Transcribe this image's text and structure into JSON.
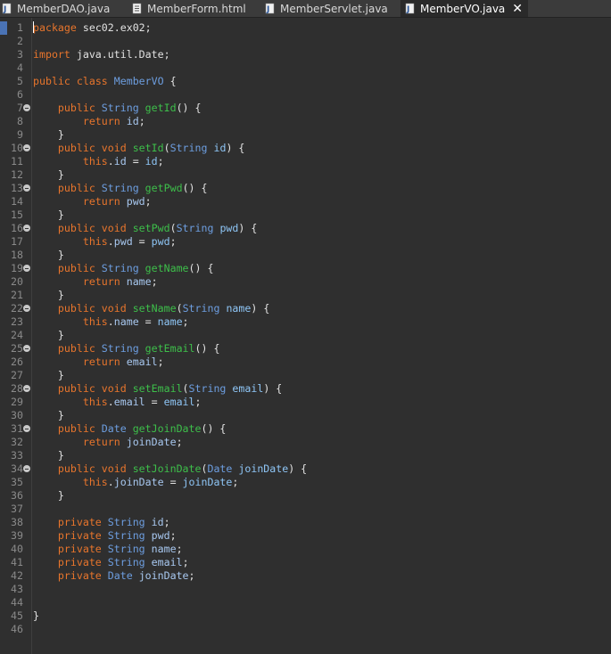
{
  "tabs": [
    {
      "label": "MemberDAO.java",
      "icon": "java-file-icon",
      "active": false
    },
    {
      "label": "MemberForm.html",
      "icon": "html-file-icon",
      "active": false
    },
    {
      "label": "MemberServlet.java",
      "icon": "java-file-icon",
      "active": false
    },
    {
      "label": "MemberVO.java",
      "icon": "java-file-icon",
      "active": true,
      "close": "✕"
    }
  ],
  "editor": {
    "lines": [
      {
        "n": "1",
        "fold": false,
        "segs": [
          [
            "package",
            "k"
          ],
          [
            " sec02.ex02;",
            "o"
          ]
        ]
      },
      {
        "n": "2",
        "fold": false,
        "segs": []
      },
      {
        "n": "3",
        "fold": false,
        "segs": [
          [
            "import",
            "k"
          ],
          [
            " java.util.Date;",
            "o"
          ]
        ]
      },
      {
        "n": "4",
        "fold": false,
        "segs": []
      },
      {
        "n": "5",
        "fold": false,
        "segs": [
          [
            "public",
            "k"
          ],
          [
            " ",
            "o"
          ],
          [
            "class",
            "k"
          ],
          [
            " ",
            "o"
          ],
          [
            "MemberVO",
            "t"
          ],
          [
            " {",
            "o"
          ]
        ]
      },
      {
        "n": "6",
        "fold": false,
        "segs": []
      },
      {
        "n": "7",
        "fold": true,
        "segs": [
          [
            "    ",
            "o"
          ],
          [
            "public",
            "k"
          ],
          [
            " ",
            "o"
          ],
          [
            "String",
            "t"
          ],
          [
            " ",
            "o"
          ],
          [
            "getId",
            "m"
          ],
          [
            "() {",
            "o"
          ]
        ]
      },
      {
        "n": "8",
        "fold": false,
        "segs": [
          [
            "        ",
            "o"
          ],
          [
            "return",
            "k"
          ],
          [
            " ",
            "o"
          ],
          [
            "id",
            "f"
          ],
          [
            ";",
            "o"
          ]
        ]
      },
      {
        "n": "9",
        "fold": false,
        "segs": [
          [
            "    }",
            "o"
          ]
        ]
      },
      {
        "n": "10",
        "fold": true,
        "segs": [
          [
            "    ",
            "o"
          ],
          [
            "public",
            "k"
          ],
          [
            " ",
            "o"
          ],
          [
            "void",
            "k"
          ],
          [
            " ",
            "o"
          ],
          [
            "setId",
            "m"
          ],
          [
            "(",
            "o"
          ],
          [
            "String",
            "t"
          ],
          [
            " ",
            "o"
          ],
          [
            "id",
            "p"
          ],
          [
            ") {",
            "o"
          ]
        ]
      },
      {
        "n": "11",
        "fold": false,
        "segs": [
          [
            "        ",
            "o"
          ],
          [
            "this",
            "k"
          ],
          [
            ".",
            "o"
          ],
          [
            "id",
            "f"
          ],
          [
            " = ",
            "o"
          ],
          [
            "id",
            "p"
          ],
          [
            ";",
            "o"
          ]
        ]
      },
      {
        "n": "12",
        "fold": false,
        "segs": [
          [
            "    }",
            "o"
          ]
        ]
      },
      {
        "n": "13",
        "fold": true,
        "segs": [
          [
            "    ",
            "o"
          ],
          [
            "public",
            "k"
          ],
          [
            " ",
            "o"
          ],
          [
            "String",
            "t"
          ],
          [
            " ",
            "o"
          ],
          [
            "getPwd",
            "m"
          ],
          [
            "() {",
            "o"
          ]
        ]
      },
      {
        "n": "14",
        "fold": false,
        "segs": [
          [
            "        ",
            "o"
          ],
          [
            "return",
            "k"
          ],
          [
            " ",
            "o"
          ],
          [
            "pwd",
            "f"
          ],
          [
            ";",
            "o"
          ]
        ]
      },
      {
        "n": "15",
        "fold": false,
        "segs": [
          [
            "    }",
            "o"
          ]
        ]
      },
      {
        "n": "16",
        "fold": true,
        "segs": [
          [
            "    ",
            "o"
          ],
          [
            "public",
            "k"
          ],
          [
            " ",
            "o"
          ],
          [
            "void",
            "k"
          ],
          [
            " ",
            "o"
          ],
          [
            "setPwd",
            "m"
          ],
          [
            "(",
            "o"
          ],
          [
            "String",
            "t"
          ],
          [
            " ",
            "o"
          ],
          [
            "pwd",
            "p"
          ],
          [
            ") {",
            "o"
          ]
        ]
      },
      {
        "n": "17",
        "fold": false,
        "segs": [
          [
            "        ",
            "o"
          ],
          [
            "this",
            "k"
          ],
          [
            ".",
            "o"
          ],
          [
            "pwd",
            "f"
          ],
          [
            " = ",
            "o"
          ],
          [
            "pwd",
            "p"
          ],
          [
            ";",
            "o"
          ]
        ]
      },
      {
        "n": "18",
        "fold": false,
        "segs": [
          [
            "    }",
            "o"
          ]
        ]
      },
      {
        "n": "19",
        "fold": true,
        "segs": [
          [
            "    ",
            "o"
          ],
          [
            "public",
            "k"
          ],
          [
            " ",
            "o"
          ],
          [
            "String",
            "t"
          ],
          [
            " ",
            "o"
          ],
          [
            "getName",
            "m"
          ],
          [
            "() {",
            "o"
          ]
        ]
      },
      {
        "n": "20",
        "fold": false,
        "segs": [
          [
            "        ",
            "o"
          ],
          [
            "return",
            "k"
          ],
          [
            " ",
            "o"
          ],
          [
            "name",
            "f"
          ],
          [
            ";",
            "o"
          ]
        ]
      },
      {
        "n": "21",
        "fold": false,
        "segs": [
          [
            "    }",
            "o"
          ]
        ]
      },
      {
        "n": "22",
        "fold": true,
        "segs": [
          [
            "    ",
            "o"
          ],
          [
            "public",
            "k"
          ],
          [
            " ",
            "o"
          ],
          [
            "void",
            "k"
          ],
          [
            " ",
            "o"
          ],
          [
            "setName",
            "m"
          ],
          [
            "(",
            "o"
          ],
          [
            "String",
            "t"
          ],
          [
            " ",
            "o"
          ],
          [
            "name",
            "p"
          ],
          [
            ") {",
            "o"
          ]
        ]
      },
      {
        "n": "23",
        "fold": false,
        "segs": [
          [
            "        ",
            "o"
          ],
          [
            "this",
            "k"
          ],
          [
            ".",
            "o"
          ],
          [
            "name",
            "f"
          ],
          [
            " = ",
            "o"
          ],
          [
            "name",
            "p"
          ],
          [
            ";",
            "o"
          ]
        ]
      },
      {
        "n": "24",
        "fold": false,
        "segs": [
          [
            "    }",
            "o"
          ]
        ]
      },
      {
        "n": "25",
        "fold": true,
        "segs": [
          [
            "    ",
            "o"
          ],
          [
            "public",
            "k"
          ],
          [
            " ",
            "o"
          ],
          [
            "String",
            "t"
          ],
          [
            " ",
            "o"
          ],
          [
            "getEmail",
            "m"
          ],
          [
            "() {",
            "o"
          ]
        ]
      },
      {
        "n": "26",
        "fold": false,
        "segs": [
          [
            "        ",
            "o"
          ],
          [
            "return",
            "k"
          ],
          [
            " ",
            "o"
          ],
          [
            "email",
            "f"
          ],
          [
            ";",
            "o"
          ]
        ]
      },
      {
        "n": "27",
        "fold": false,
        "segs": [
          [
            "    }",
            "o"
          ]
        ]
      },
      {
        "n": "28",
        "fold": true,
        "segs": [
          [
            "    ",
            "o"
          ],
          [
            "public",
            "k"
          ],
          [
            " ",
            "o"
          ],
          [
            "void",
            "k"
          ],
          [
            " ",
            "o"
          ],
          [
            "setEmail",
            "m"
          ],
          [
            "(",
            "o"
          ],
          [
            "String",
            "t"
          ],
          [
            " ",
            "o"
          ],
          [
            "email",
            "p"
          ],
          [
            ") {",
            "o"
          ]
        ]
      },
      {
        "n": "29",
        "fold": false,
        "segs": [
          [
            "        ",
            "o"
          ],
          [
            "this",
            "k"
          ],
          [
            ".",
            "o"
          ],
          [
            "email",
            "f"
          ],
          [
            " = ",
            "o"
          ],
          [
            "email",
            "p"
          ],
          [
            ";",
            "o"
          ]
        ]
      },
      {
        "n": "30",
        "fold": false,
        "segs": [
          [
            "    }",
            "o"
          ]
        ]
      },
      {
        "n": "31",
        "fold": true,
        "segs": [
          [
            "    ",
            "o"
          ],
          [
            "public",
            "k"
          ],
          [
            " ",
            "o"
          ],
          [
            "Date",
            "t"
          ],
          [
            " ",
            "o"
          ],
          [
            "getJoinDate",
            "m"
          ],
          [
            "() {",
            "o"
          ]
        ]
      },
      {
        "n": "32",
        "fold": false,
        "segs": [
          [
            "        ",
            "o"
          ],
          [
            "return",
            "k"
          ],
          [
            " ",
            "o"
          ],
          [
            "joinDate",
            "f"
          ],
          [
            ";",
            "o"
          ]
        ]
      },
      {
        "n": "33",
        "fold": false,
        "segs": [
          [
            "    }",
            "o"
          ]
        ]
      },
      {
        "n": "34",
        "fold": true,
        "segs": [
          [
            "    ",
            "o"
          ],
          [
            "public",
            "k"
          ],
          [
            " ",
            "o"
          ],
          [
            "void",
            "k"
          ],
          [
            " ",
            "o"
          ],
          [
            "setJoinDate",
            "m"
          ],
          [
            "(",
            "o"
          ],
          [
            "Date",
            "t"
          ],
          [
            " ",
            "o"
          ],
          [
            "joinDate",
            "p"
          ],
          [
            ") {",
            "o"
          ]
        ]
      },
      {
        "n": "35",
        "fold": false,
        "segs": [
          [
            "        ",
            "o"
          ],
          [
            "this",
            "k"
          ],
          [
            ".",
            "o"
          ],
          [
            "joinDate",
            "f"
          ],
          [
            " = ",
            "o"
          ],
          [
            "joinDate",
            "p"
          ],
          [
            ";",
            "o"
          ]
        ]
      },
      {
        "n": "36",
        "fold": false,
        "segs": [
          [
            "    }",
            "o"
          ]
        ]
      },
      {
        "n": "37",
        "fold": false,
        "segs": []
      },
      {
        "n": "38",
        "fold": false,
        "segs": [
          [
            "    ",
            "o"
          ],
          [
            "private",
            "k"
          ],
          [
            " ",
            "o"
          ],
          [
            "String",
            "t"
          ],
          [
            " ",
            "o"
          ],
          [
            "id",
            "f"
          ],
          [
            ";",
            "o"
          ]
        ]
      },
      {
        "n": "39",
        "fold": false,
        "segs": [
          [
            "    ",
            "o"
          ],
          [
            "private",
            "k"
          ],
          [
            " ",
            "o"
          ],
          [
            "String",
            "t"
          ],
          [
            " ",
            "o"
          ],
          [
            "pwd",
            "f"
          ],
          [
            ";",
            "o"
          ]
        ]
      },
      {
        "n": "40",
        "fold": false,
        "segs": [
          [
            "    ",
            "o"
          ],
          [
            "private",
            "k"
          ],
          [
            " ",
            "o"
          ],
          [
            "String",
            "t"
          ],
          [
            " ",
            "o"
          ],
          [
            "name",
            "f"
          ],
          [
            ";",
            "o"
          ]
        ]
      },
      {
        "n": "41",
        "fold": false,
        "segs": [
          [
            "    ",
            "o"
          ],
          [
            "private",
            "k"
          ],
          [
            " ",
            "o"
          ],
          [
            "String",
            "t"
          ],
          [
            " ",
            "o"
          ],
          [
            "email",
            "f"
          ],
          [
            ";",
            "o"
          ]
        ]
      },
      {
        "n": "42",
        "fold": false,
        "segs": [
          [
            "    ",
            "o"
          ],
          [
            "private",
            "k"
          ],
          [
            " ",
            "o"
          ],
          [
            "Date",
            "t"
          ],
          [
            " ",
            "o"
          ],
          [
            "joinDate",
            "f"
          ],
          [
            ";",
            "o"
          ]
        ]
      },
      {
        "n": "43",
        "fold": false,
        "segs": []
      },
      {
        "n": "44",
        "fold": false,
        "segs": []
      },
      {
        "n": "45",
        "fold": false,
        "segs": [
          [
            "}",
            "o"
          ]
        ]
      },
      {
        "n": "46",
        "fold": false,
        "segs": []
      }
    ]
  },
  "colors": {
    "keyword": "#e8752c",
    "type": "#6d9ee0",
    "method": "#3dbf4a",
    "parameter": "#8ec5f5",
    "field": "#a8c8f0",
    "background": "#2f2f2f"
  }
}
